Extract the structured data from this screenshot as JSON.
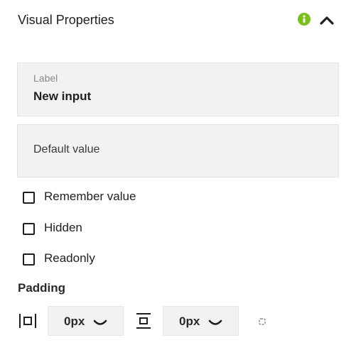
{
  "header": {
    "title": "Visual Properties",
    "info_icon": "info-circle-icon",
    "collapse_icon": "chevron-up-icon",
    "accent_color": "#7bc11b"
  },
  "label_field": {
    "label": "Label",
    "value": "New input"
  },
  "default_field": {
    "placeholder": "Default value"
  },
  "options": [
    {
      "label": "Remember value",
      "checked": false
    },
    {
      "label": "Hidden",
      "checked": false
    },
    {
      "label": "Readonly",
      "checked": false
    }
  ],
  "padding": {
    "title": "Padding",
    "horizontal": {
      "icon": "horizontal-padding-icon",
      "value": "0px"
    },
    "vertical": {
      "icon": "vertical-padding-icon",
      "value": "0px"
    },
    "link_icon": "link-toggle-icon"
  }
}
